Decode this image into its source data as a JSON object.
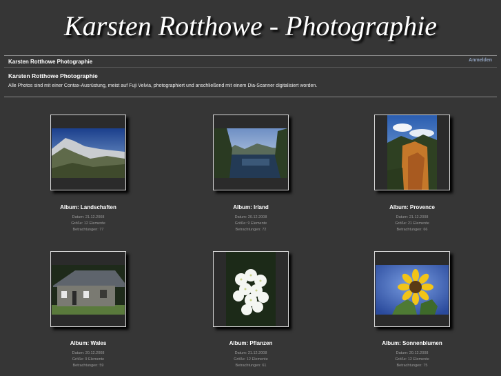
{
  "header": {
    "site_title": "Karsten Rotthowe - Photographie",
    "breadcrumb": "Karsten Rotthowe Photographie",
    "login_label": "Anmelden"
  },
  "gallery": {
    "title": "Karsten Rotthowe Photographie",
    "description": "Alle Photos sind mit einer Contax-Ausrüstung, meist auf Fuji Velvia, photographiert und anschließend mit einem Dia-Scanner digitalisiert worden."
  },
  "albums": [
    {
      "title": "Album: Landschaften",
      "date": "Datum: 21.12.2008",
      "size": "Größe: 12 Elemente",
      "views": "Betrachtungen: 77"
    },
    {
      "title": "Album: Irland",
      "date": "Datum: 20.12.2008",
      "size": "Größe: 9 Elemente",
      "views": "Betrachtungen: 72"
    },
    {
      "title": "Album: Provence",
      "date": "Datum: 21.12.2008",
      "size": "Größe: 21 Elemente",
      "views": "Betrachtungen: 66"
    },
    {
      "title": "Album: Wales",
      "date": "Datum: 20.12.2008",
      "size": "Größe: 9 Elemente",
      "views": "Betrachtungen: 59"
    },
    {
      "title": "Album: Pflanzen",
      "date": "Datum: 21.12.2008",
      "size": "Größe: 12 Elemente",
      "views": "Betrachtungen: 61"
    },
    {
      "title": "Album: Sonnenblumen",
      "date": "Datum: 20.12.2008",
      "size": "Größe: 12 Elemente",
      "views": "Betrachtungen: 75"
    }
  ]
}
